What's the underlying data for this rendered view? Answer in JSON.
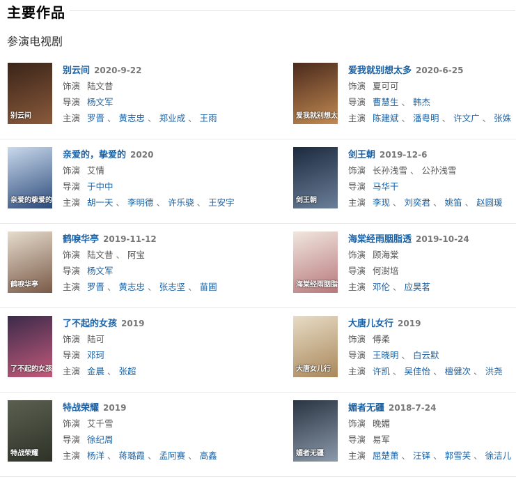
{
  "section": {
    "title": "主要作品"
  },
  "subsection": {
    "title": "参演电视剧"
  },
  "labels": {
    "role": "饰演",
    "director": "导演",
    "cast": "主演"
  },
  "works": [
    {
      "title": "别云间",
      "date": "2020-9-22",
      "roles": [
        {
          "name": "陆文昔",
          "link": false
        }
      ],
      "directors": [
        {
          "name": "杨文军",
          "link": true
        }
      ],
      "cast": [
        {
          "name": "罗晋",
          "link": true
        },
        {
          "name": "黄志忠",
          "link": true
        },
        {
          "name": "郑业成",
          "link": true
        },
        {
          "name": "王雨",
          "link": true
        }
      ],
      "poster": {
        "colors": [
          "#3a2418",
          "#8a5a3c"
        ],
        "caption": "别云间"
      }
    },
    {
      "title": "爱我就别想太多",
      "date": "2020-6-25",
      "roles": [
        {
          "name": "夏可可",
          "link": false
        }
      ],
      "directors": [
        {
          "name": "曹慧生",
          "link": true
        },
        {
          "name": "韩杰",
          "link": true
        }
      ],
      "cast": [
        {
          "name": "陈建斌",
          "link": true
        },
        {
          "name": "潘粤明",
          "link": true
        },
        {
          "name": "许文广",
          "link": true
        },
        {
          "name": "张姝",
          "link": true
        }
      ],
      "poster": {
        "colors": [
          "#4a2a1c",
          "#c28a52"
        ],
        "caption": "爱我就别想太多"
      }
    },
    {
      "title": "亲爱的，挚爱的",
      "date": "2020",
      "roles": [
        {
          "name": "艾情",
          "link": false
        }
      ],
      "directors": [
        {
          "name": "于中中",
          "link": true
        }
      ],
      "cast": [
        {
          "name": "胡一天",
          "link": true
        },
        {
          "name": "李明德",
          "link": true
        },
        {
          "name": "许乐骁",
          "link": true
        },
        {
          "name": "王安宇",
          "link": true
        }
      ],
      "poster": {
        "colors": [
          "#c9d9ec",
          "#2c4a7a"
        ],
        "caption": "亲爱的挚爱的"
      }
    },
    {
      "title": "剑王朝",
      "date": "2019-12-6",
      "roles": [
        {
          "name": "长孙浅雪",
          "link": false
        },
        {
          "name": "公孙浅雪",
          "link": false
        }
      ],
      "directors": [
        {
          "name": "马华干",
          "link": true
        }
      ],
      "cast": [
        {
          "name": "李现",
          "link": true
        },
        {
          "name": "刘奕君",
          "link": true
        },
        {
          "name": "姚笛",
          "link": true
        },
        {
          "name": "赵圆瑗",
          "link": true
        }
      ],
      "poster": {
        "colors": [
          "#1c2a3e",
          "#6b7f99"
        ],
        "caption": "剑王朝"
      }
    },
    {
      "title": "鹤唳华亭",
      "date": "2019-11-12",
      "roles": [
        {
          "name": "陆文昔",
          "link": false
        },
        {
          "name": "阿宝",
          "link": false
        }
      ],
      "directors": [
        {
          "name": "杨文军",
          "link": true
        }
      ],
      "cast": [
        {
          "name": "罗晋",
          "link": true
        },
        {
          "name": "黄志忠",
          "link": true
        },
        {
          "name": "张志坚",
          "link": true
        },
        {
          "name": "苗圃",
          "link": true
        }
      ],
      "poster": {
        "colors": [
          "#e6dccd",
          "#7a5a48"
        ],
        "caption": "鹤唳华亭"
      }
    },
    {
      "title": "海棠经雨胭脂透",
      "date": "2019-10-24",
      "roles": [
        {
          "name": "顾海棠",
          "link": false
        }
      ],
      "directors": [
        {
          "name": "何澍培",
          "link": false
        }
      ],
      "cast": [
        {
          "name": "邓伦",
          "link": true
        },
        {
          "name": "应昊茗",
          "link": true
        }
      ],
      "poster": {
        "colors": [
          "#f1e6df",
          "#b7787a"
        ],
        "caption": "海棠经雨胭脂透"
      }
    },
    {
      "title": "了不起的女孩",
      "date": "2019",
      "roles": [
        {
          "name": "陆可",
          "link": false
        }
      ],
      "directors": [
        {
          "name": "邓珂",
          "link": true
        }
      ],
      "cast": [
        {
          "name": "金晨",
          "link": true
        },
        {
          "name": "张超",
          "link": true
        }
      ],
      "poster": {
        "colors": [
          "#3b2a4a",
          "#c35a7a"
        ],
        "caption": "了不起的女孩"
      }
    },
    {
      "title": "大唐儿女行",
      "date": "2019",
      "roles": [
        {
          "name": "傅柔",
          "link": false
        }
      ],
      "directors": [
        {
          "name": "王晓明",
          "link": true
        },
        {
          "name": "白云默",
          "link": true
        }
      ],
      "cast": [
        {
          "name": "许凯",
          "link": true
        },
        {
          "name": "吴佳怡",
          "link": true
        },
        {
          "name": "檀健次",
          "link": true
        },
        {
          "name": "洪尧",
          "link": true
        }
      ],
      "poster": {
        "colors": [
          "#e7dcc6",
          "#a9875a"
        ],
        "caption": "大唐女儿行"
      }
    },
    {
      "title": "特战荣耀",
      "date": "2019",
      "roles": [
        {
          "name": "艾千雪",
          "link": false
        }
      ],
      "directors": [
        {
          "name": "徐纪周",
          "link": true
        }
      ],
      "cast": [
        {
          "name": "杨洋",
          "link": true
        },
        {
          "name": "蒋璐霞",
          "link": true
        },
        {
          "name": "孟阿赛",
          "link": true
        },
        {
          "name": "高鑫",
          "link": true
        }
      ],
      "poster": {
        "colors": [
          "#5a6050",
          "#2e3228"
        ],
        "caption": "特战荣耀"
      }
    },
    {
      "title": "媚者无疆",
      "date": "2018-7-24",
      "roles": [
        {
          "name": "晚媚",
          "link": false
        }
      ],
      "directors": [
        {
          "name": "易军",
          "link": false
        }
      ],
      "cast": [
        {
          "name": "屈楚萧",
          "link": true
        },
        {
          "name": "汪铎",
          "link": true
        },
        {
          "name": "郭雪芙",
          "link": true
        },
        {
          "name": "徐洁儿",
          "link": true
        }
      ],
      "poster": {
        "colors": [
          "#2a3442",
          "#8b9aab"
        ],
        "caption": "媚者无疆"
      }
    }
  ]
}
